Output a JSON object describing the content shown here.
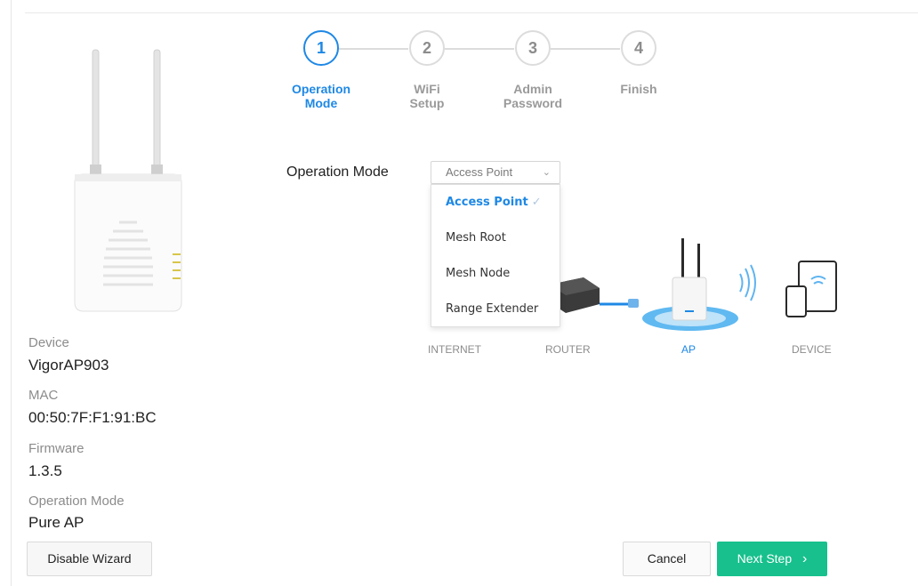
{
  "device_info": {
    "device_label": "Device",
    "device_value": "VigorAP903",
    "mac_label": "MAC",
    "mac_value": "00:50:7F:F1:91:BC",
    "firmware_label": "Firmware",
    "firmware_value": "1.3.5",
    "opmode_label": "Operation Mode",
    "opmode_value": "Pure AP"
  },
  "stepper": {
    "steps": [
      {
        "number": "1",
        "label_line1": "Operation",
        "label_line2": "Mode"
      },
      {
        "number": "2",
        "label_line1": "WiFi",
        "label_line2": "Setup"
      },
      {
        "number": "3",
        "label_line1": "Admin",
        "label_line2": "Password"
      },
      {
        "number": "4",
        "label_line1": "Finish",
        "label_line2": ""
      }
    ],
    "active_step": 1,
    "active_color": "#1e88e5",
    "inactive_color": "#9a9a9a"
  },
  "form": {
    "operation_mode_label": "Operation Mode",
    "selected_value": "Access Point",
    "options": [
      "Access Point",
      "Mesh Root",
      "Mesh Node",
      "Range Extender"
    ],
    "selected_mark": "✓"
  },
  "topology": {
    "labels": [
      "INTERNET",
      "ROUTER",
      "AP",
      "DEVICE"
    ],
    "active_label": "AP"
  },
  "buttons": {
    "disable_wizard": "Disable Wizard",
    "cancel": "Cancel",
    "next_step": "Next Step",
    "next_icon": "chevron-right-icon",
    "next_color": "#17c08c"
  }
}
